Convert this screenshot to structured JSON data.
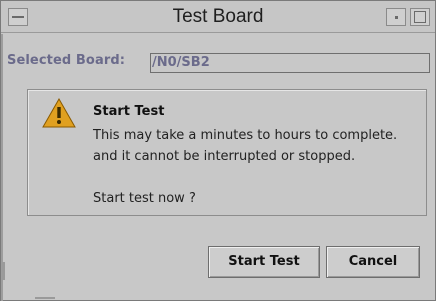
{
  "window": {
    "title": "Test Board"
  },
  "selected_board": {
    "label": "Selected Board:",
    "value": "/N0/SB2"
  },
  "message": {
    "title": "Start Test",
    "lines": [
      "This may take a minutes to hours to complete.",
      "and it cannot be interrupted or stopped.",
      "",
      "Start test now ?"
    ],
    "icon": "warning-icon"
  },
  "buttons": {
    "start_label": "Start Test",
    "cancel_label": "Cancel"
  },
  "colors": {
    "background": "#c8c8c8",
    "label_text": "#6b6b8b",
    "warning_fill": "#e0a020"
  }
}
